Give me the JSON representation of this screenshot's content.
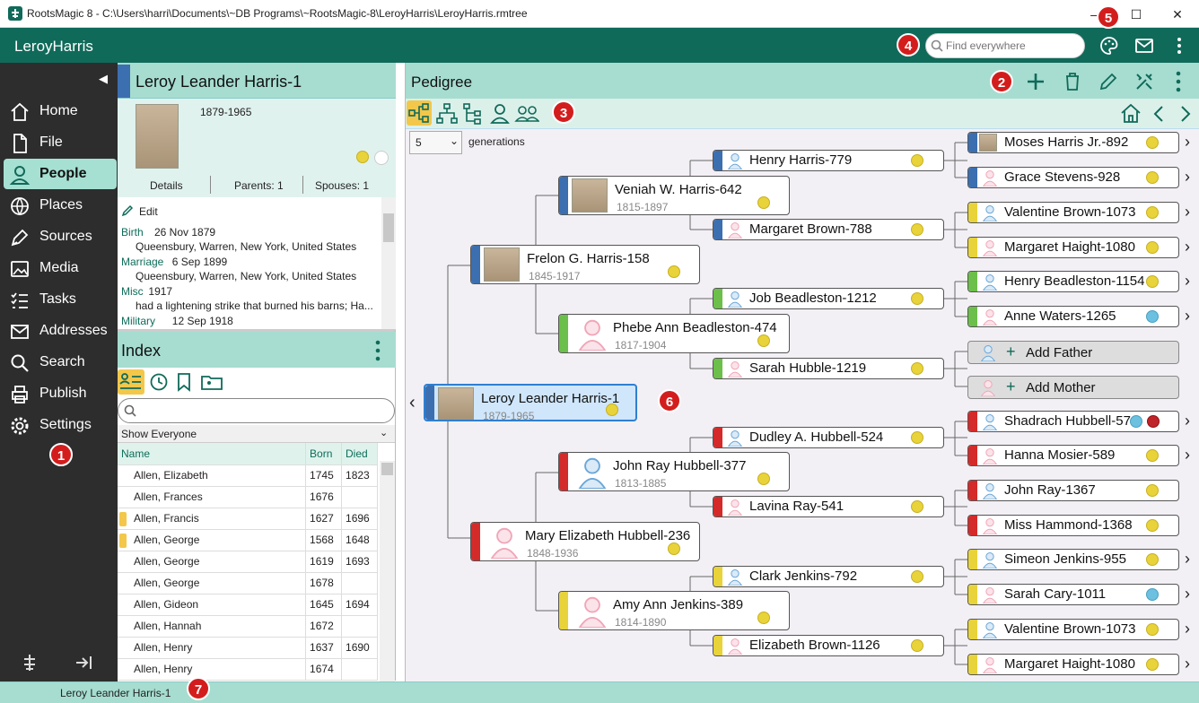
{
  "window": {
    "title": "RootsMagic 8 - C:\\Users\\harri\\Documents\\~DB Programs\\~RootsMagic-8\\LeroyHarris\\LeroyHarris.rmtree",
    "min_symbol": "–",
    "max_symbol": "☐",
    "close_symbol": "✕"
  },
  "appbar": {
    "name": "LeroyHarris",
    "search_placeholder": "Find everywhere"
  },
  "sidebar": {
    "items": [
      {
        "label": "Home",
        "icon": "home-icon"
      },
      {
        "label": "File",
        "icon": "file-icon"
      },
      {
        "label": "People",
        "icon": "person-icon",
        "selected": true
      },
      {
        "label": "Places",
        "icon": "globe-icon"
      },
      {
        "label": "Sources",
        "icon": "pen-icon"
      },
      {
        "label": "Media",
        "icon": "image-icon"
      },
      {
        "label": "Tasks",
        "icon": "tasks-icon"
      },
      {
        "label": "Addresses",
        "icon": "mail-icon"
      },
      {
        "label": "Search",
        "icon": "search-icon"
      },
      {
        "label": "Publish",
        "icon": "printer-icon"
      },
      {
        "label": "Settings",
        "icon": "gear-icon"
      }
    ]
  },
  "person": {
    "name": "Leroy Leander Harris-1",
    "years": "1879-1965",
    "tabs": {
      "details": "Details",
      "parents": "Parents: 1",
      "spouses": "Spouses: 1"
    },
    "edit_label": "Edit",
    "facts": [
      {
        "label": "Birth",
        "date": "26 Nov 1879",
        "detail": "Queensbury, Warren, New York, United States"
      },
      {
        "label": "Marriage",
        "date": "6 Sep 1899",
        "detail": "Queensbury, Warren, New York, United States"
      },
      {
        "label": "Misc",
        "date": "1917",
        "detail": "had a  lightening strike that burned his barns; Ha..."
      },
      {
        "label": "Military",
        "date": "12 Sep 1918",
        "detail": ""
      }
    ]
  },
  "index": {
    "title": "Index",
    "filter": "Show Everyone",
    "columns": {
      "name": "Name",
      "born": "Born",
      "died": "Died"
    },
    "rows": [
      {
        "name": "Allen, Elizabeth",
        "born": "1745",
        "died": "1823",
        "flag": false
      },
      {
        "name": "Allen, Frances",
        "born": "1676",
        "died": "",
        "flag": false
      },
      {
        "name": "Allen, Francis",
        "born": "1627",
        "died": "1696",
        "flag": true
      },
      {
        "name": "Allen, George",
        "born": "1568",
        "died": "1648",
        "flag": true
      },
      {
        "name": "Allen, George",
        "born": "1619",
        "died": "1693",
        "flag": false
      },
      {
        "name": "Allen, George",
        "born": "1678",
        "died": "",
        "flag": false
      },
      {
        "name": "Allen, Gideon",
        "born": "1645",
        "died": "1694",
        "flag": false
      },
      {
        "name": "Allen, Hannah",
        "born": "1672",
        "died": "",
        "flag": false
      },
      {
        "name": "Allen, Henry",
        "born": "1637",
        "died": "1690",
        "flag": false
      },
      {
        "name": "Allen, Henry",
        "born": "1674",
        "died": "",
        "flag": false
      }
    ]
  },
  "pedigree": {
    "title": "Pedigree",
    "generations_value": "5",
    "generations_label": "generations",
    "root": {
      "name": "Leroy Leander Harris-1",
      "years": "1879-1965"
    },
    "gen2": [
      {
        "name": "Frelon G. Harris-158",
        "years": "1845-1917"
      },
      {
        "name": "Mary Elizabeth Hubbell-236",
        "years": "1848-1936"
      }
    ],
    "gen3": [
      {
        "name": "Veniah W. Harris-642",
        "years": "1815-1897"
      },
      {
        "name": "Phebe Ann Beadleston-474",
        "years": "1817-1904"
      },
      {
        "name": "John Ray Hubbell-377",
        "years": "1813-1885"
      },
      {
        "name": "Amy Ann Jenkins-389",
        "years": "1814-1890"
      }
    ],
    "gen4": [
      "Henry Harris-779",
      "Margaret Brown-788",
      "Job Beadleston-1212",
      "Sarah Hubble-1219",
      "Dudley A. Hubbell-524",
      "Lavina Ray-541",
      "Clark Jenkins-792",
      "Elizabeth Brown-1126"
    ],
    "gen5": [
      "Moses Harris Jr.-892",
      "Grace Stevens-928",
      "Valentine Brown-1073",
      "Margaret Haight-1080",
      "Henry Beadleston-1154",
      "Anne Waters-1265",
      "Add Father",
      "Add Mother",
      "Shadrach Hubbell-574",
      "Hanna Mosier-589",
      "John Ray-1367",
      "Miss Hammond-1368",
      "Simeon Jenkins-955",
      "Sarah Cary-1011",
      "Valentine Brown-1073",
      "Margaret Haight-1080"
    ]
  },
  "status": {
    "text": "Leroy Leander Harris-1"
  },
  "callouts": [
    "1",
    "2",
    "3",
    "4",
    "5",
    "6",
    "7"
  ],
  "colors": {
    "teal": "#106a5a",
    "mint": "#a6ddd0",
    "blue": "#3c6fb0",
    "green": "#6cbf4a",
    "red": "#d42a2a",
    "yellow": "#e8d33a",
    "callout": "#d31d1d"
  }
}
